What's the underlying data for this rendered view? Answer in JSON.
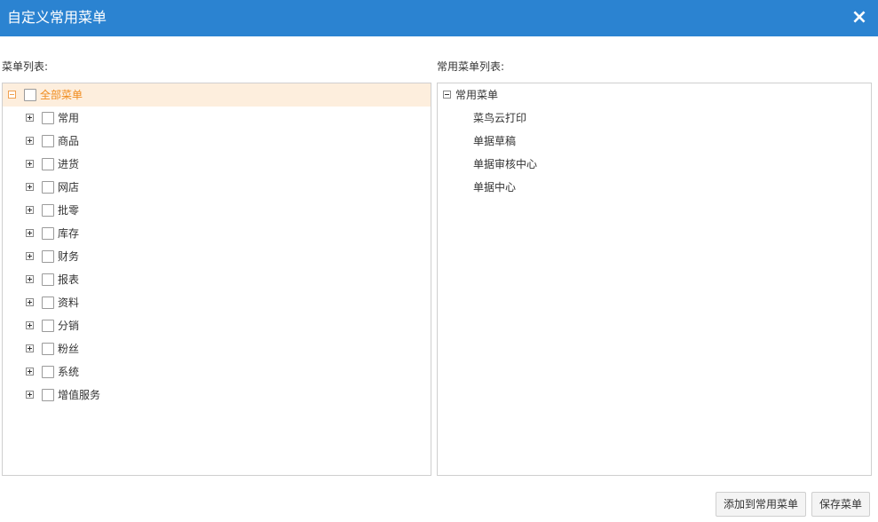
{
  "dialog": {
    "title": "自定义常用菜单",
    "close_icon": "×"
  },
  "left_panel": {
    "label": "菜单列表:",
    "root": {
      "label": "全部菜单"
    },
    "items": [
      {
        "label": "常用"
      },
      {
        "label": "商品"
      },
      {
        "label": "进货"
      },
      {
        "label": "网店"
      },
      {
        "label": "批零"
      },
      {
        "label": "库存"
      },
      {
        "label": "财务"
      },
      {
        "label": "报表"
      },
      {
        "label": "资料"
      },
      {
        "label": "分销"
      },
      {
        "label": "粉丝"
      },
      {
        "label": "系统"
      },
      {
        "label": "增值服务"
      }
    ]
  },
  "right_panel": {
    "label": "常用菜单列表:",
    "root": {
      "label": "常用菜单"
    },
    "items": [
      {
        "label": "菜鸟云打印"
      },
      {
        "label": "单据草稿"
      },
      {
        "label": "单据审核中心"
      },
      {
        "label": "单据中心"
      }
    ]
  },
  "buttons": {
    "add": "添加到常用菜单",
    "save": "保存菜单"
  },
  "colors": {
    "titlebar": "#2b83d1",
    "selected_row": "#fdeedd",
    "selected_text": "#f08c1e"
  }
}
